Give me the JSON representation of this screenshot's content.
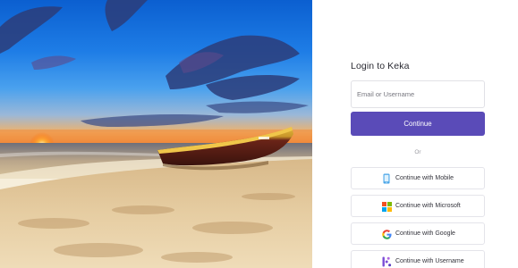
{
  "hero": {
    "image": "beach-sunset-with-wooden-boat"
  },
  "login": {
    "title": "Login to Keka",
    "username_placeholder": "Email or Username",
    "continue_label": "Continue",
    "or_label": "Or"
  },
  "sso": [
    {
      "label": "Continue with Mobile",
      "icon": "mobile-icon"
    },
    {
      "label": "Continue with Microsoft",
      "icon": "microsoft-icon"
    },
    {
      "label": "Continue with Google",
      "icon": "google-icon"
    },
    {
      "label": "Continue with Username",
      "icon": "keka-icon"
    }
  ],
  "colors": {
    "primary": "#5a4bb8",
    "border": "#e1e1e6",
    "text": "#2b2b33",
    "keka_brand": "#7b4dd6"
  }
}
